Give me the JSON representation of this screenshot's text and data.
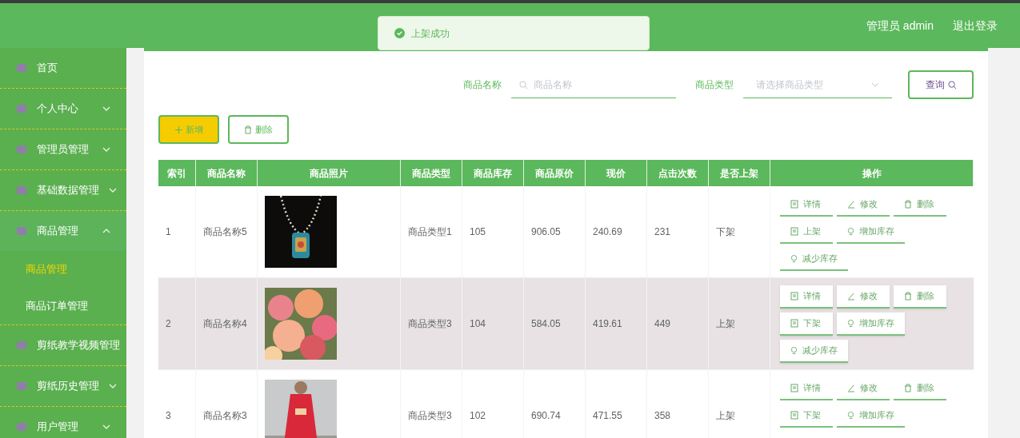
{
  "header": {
    "user": "管理员 admin",
    "logout": "退出登录"
  },
  "toast": {
    "message": "上架成功"
  },
  "sidebar": {
    "items": [
      {
        "label": "首页"
      },
      {
        "label": "个人中心",
        "expanded": false
      },
      {
        "label": "管理员管理",
        "expanded": false
      },
      {
        "label": "基础数据管理",
        "expanded": false
      },
      {
        "label": "商品管理",
        "expanded": true,
        "children": [
          {
            "label": "商品管理",
            "selected": true
          },
          {
            "label": "商品订单管理",
            "selected": false
          }
        ]
      },
      {
        "label": "剪纸教学视频管理"
      },
      {
        "label": "剪纸历史管理",
        "expanded": false
      },
      {
        "label": "用户管理",
        "expanded": false
      }
    ]
  },
  "search": {
    "name_label": "商品名称",
    "name_placeholder": "商品名称",
    "type_label": "商品类型",
    "type_placeholder": "请选择商品类型",
    "query_button": "查询"
  },
  "toolbar": {
    "add_button": "新增",
    "delete_button": "删除"
  },
  "table": {
    "columns": [
      "索引",
      "商品名称",
      "商品照片",
      "商品类型",
      "商品库存",
      "商品原价",
      "现价",
      "点击次数",
      "是否上架",
      "操作"
    ],
    "rows": [
      {
        "selected": false,
        "index": "1",
        "name": "商品名称5",
        "type": "商品类型1",
        "stock": "105",
        "original_price": "906.05",
        "price": "240.69",
        "clicks": "231",
        "on_shelf": "下架",
        "actions": [
          {
            "kind": "detail",
            "label": "详情"
          },
          {
            "kind": "edit",
            "label": "修改"
          },
          {
            "kind": "delete",
            "label": "删除"
          },
          {
            "kind": "shelf",
            "label": "上架"
          },
          {
            "kind": "stock",
            "label": "增加库存"
          },
          {
            "kind": "stock",
            "label": "减少库存"
          }
        ]
      },
      {
        "selected": true,
        "index": "2",
        "name": "商品名称4",
        "type": "商品类型3",
        "stock": "104",
        "original_price": "584.05",
        "price": "419.61",
        "clicks": "449",
        "on_shelf": "上架",
        "actions": [
          {
            "kind": "detail",
            "label": "详情"
          },
          {
            "kind": "edit",
            "label": "修改"
          },
          {
            "kind": "delete",
            "label": "删除"
          },
          {
            "kind": "shelf",
            "label": "下架"
          },
          {
            "kind": "stock",
            "label": "增加库存"
          },
          {
            "kind": "stock",
            "label": "减少库存"
          }
        ]
      },
      {
        "selected": false,
        "index": "3",
        "name": "商品名称3",
        "type": "商品类型3",
        "stock": "102",
        "original_price": "690.74",
        "price": "471.55",
        "clicks": "358",
        "on_shelf": "上架",
        "actions": [
          {
            "kind": "detail",
            "label": "详情"
          },
          {
            "kind": "edit",
            "label": "修改"
          },
          {
            "kind": "delete",
            "label": "删除"
          },
          {
            "kind": "shelf",
            "label": "下架"
          },
          {
            "kind": "stock",
            "label": "增加库存"
          }
        ]
      }
    ]
  }
}
